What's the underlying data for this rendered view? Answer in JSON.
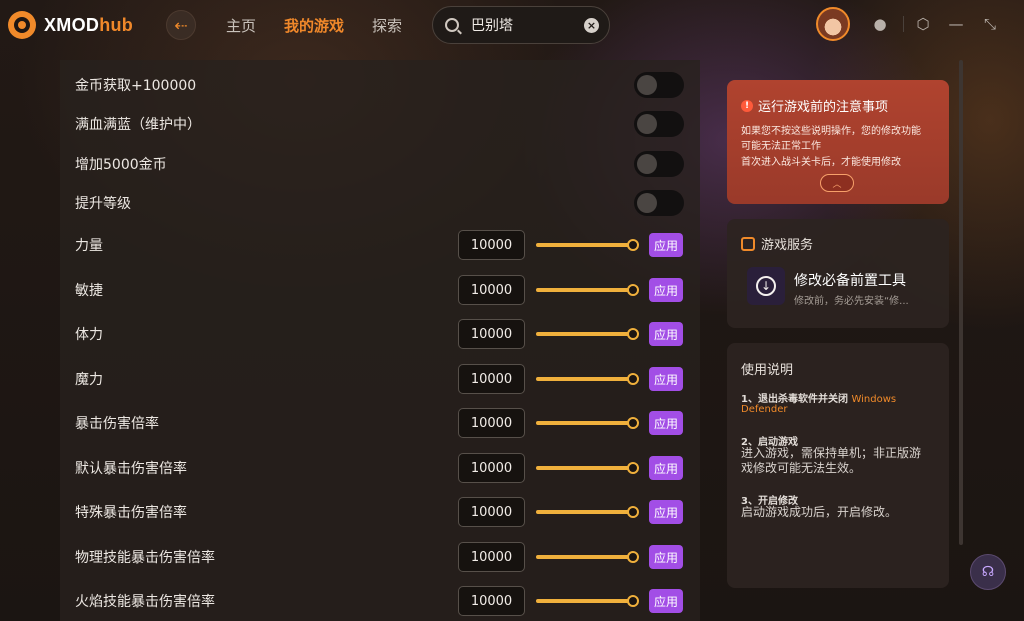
{
  "app": {
    "logo_main": "XMOD",
    "logo_accent": "hub"
  },
  "nav": {
    "back_icon": "arrow-left-icon",
    "items": [
      "主页",
      "我的游戏",
      "探索"
    ],
    "active": "我的游戏"
  },
  "search": {
    "value": "巴别塔"
  },
  "colors": {
    "accent": "#f08a2a",
    "apply": "#a24ee6",
    "slider": "#f0b03c",
    "notice": "#b0432f"
  },
  "toggles": [
    {
      "label": "金币获取+100000"
    },
    {
      "label": "满血满蓝（维护中）"
    },
    {
      "label": "增加5000金币"
    },
    {
      "label": "提升等级"
    }
  ],
  "sliders": [
    {
      "label": "力量",
      "value": "10000"
    },
    {
      "label": "敏捷",
      "value": "10000"
    },
    {
      "label": "体力",
      "value": "10000"
    },
    {
      "label": "魔力",
      "value": "10000"
    },
    {
      "label": "暴击伤害倍率",
      "value": "10000"
    },
    {
      "label": "默认暴击伤害倍率",
      "value": "10000"
    },
    {
      "label": "特殊暴击伤害倍率",
      "value": "10000"
    },
    {
      "label": "物理技能暴击伤害倍率",
      "value": "10000"
    },
    {
      "label": "火焰技能暴击伤害倍率",
      "value": "10000"
    }
  ],
  "apply_label": "应用",
  "notice": {
    "title": "运行游戏前的注意事项",
    "lines": [
      "如果您不按这些说明操作，您的修改功能",
      "可能无法正常工作",
      "首次进入战斗关卡后，才能使用修改"
    ]
  },
  "service": {
    "title": "游戏服务",
    "tool_name": "修改必备前置工具",
    "tool_desc": "修改前，务必先安装“修..."
  },
  "usage": {
    "title": "使用说明",
    "step1_title": "1、退出杀毒软件并关闭 ",
    "step1_accent": "Windows",
    "step1_accent2": "Defender",
    "step2_title": "2、启动游戏",
    "step2_body1": "进入游戏，需保持单机；非正版游",
    "step2_body2": "戏修改可能无法生效。",
    "step3_title": "3、开启修改",
    "step3_body": "启动游戏成功后，开启修改。"
  }
}
